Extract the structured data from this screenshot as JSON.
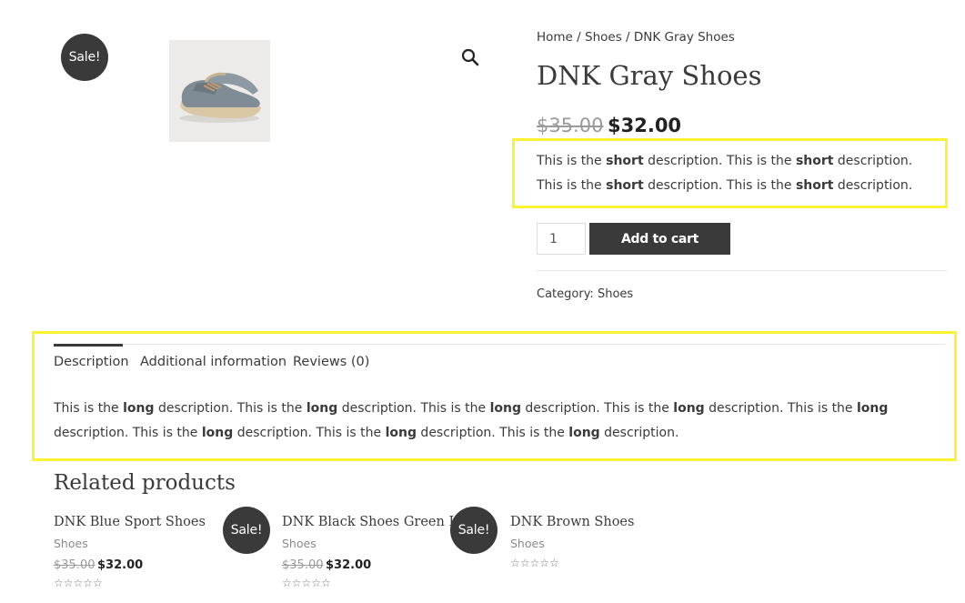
{
  "product": {
    "sale_badge": "Sale!",
    "breadcrumb": {
      "home": "Home",
      "sep1": " / ",
      "shoes": "Shoes",
      "sep2": " / ",
      "current": "DNK Gray Shoes"
    },
    "title": "DNK Gray Shoes",
    "price_old": "$35.00",
    "price_new": "$32.00",
    "short_description_parts": [
      "This is the ",
      "short",
      " description. This is the ",
      "short",
      " description. This is the ",
      "short",
      " description. This is the ",
      "short",
      " description."
    ],
    "quantity": "1",
    "add_to_cart_label": "Add to cart",
    "category_label": "Category: ",
    "category_link": "Shoes",
    "zoom_icon": "magnifier-icon"
  },
  "tabs": {
    "items": [
      {
        "label": "Description",
        "active": true
      },
      {
        "label": "Additional information",
        "active": false
      },
      {
        "label": "Reviews (0)",
        "active": false
      }
    ],
    "long_description_parts": [
      "This is the ",
      "long",
      " description. This is the ",
      "long",
      " description. This is the ",
      "long",
      " description. This is the ",
      "long",
      " description. This is the ",
      "long",
      " description. This is the ",
      "long",
      " description. This is the ",
      "long",
      " description. This is the ",
      "long",
      " description."
    ]
  },
  "related": {
    "heading": "Related products",
    "items": [
      {
        "title": "DNK Blue Sport Shoes",
        "category": "Shoes",
        "price_old": "$35.00",
        "price_new": "$32.00",
        "sale_badge": "",
        "rating": "☆☆☆☆☆"
      },
      {
        "title": "DNK Black Shoes Green LED",
        "category": "Shoes",
        "price_old": "$35.00",
        "price_new": "$32.00",
        "sale_badge": "Sale!",
        "rating": "☆☆☆☆☆"
      },
      {
        "title": "DNK Brown Shoes",
        "category": "Shoes",
        "price_old": "",
        "price_new": "",
        "sale_badge": "Sale!",
        "rating": "☆☆☆☆☆"
      }
    ]
  },
  "colors": {
    "highlight": "#fbf231",
    "dark": "#3a3a3a"
  }
}
